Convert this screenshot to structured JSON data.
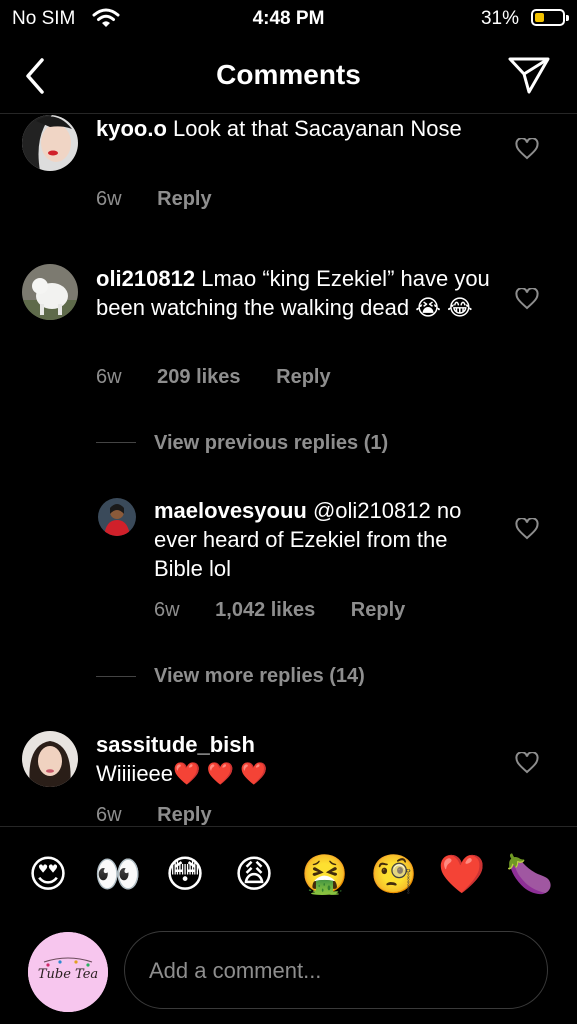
{
  "status_bar": {
    "carrier": "No SIM",
    "time": "4:48 PM",
    "battery": "31%",
    "battery_color": "#f2c200"
  },
  "header": {
    "title": "Comments"
  },
  "comments": [
    {
      "user": "kyoo.o",
      "text": "Look at that Sacayanan Nose",
      "age": "6w",
      "likes": "",
      "reply": "Reply"
    },
    {
      "user": "oli210812",
      "text": "Lmao “king Ezekiel” have you been watching the walking dead 😭 😂",
      "age": "6w",
      "likes": "209 likes",
      "reply": "Reply",
      "view_previous": "View previous replies (1)",
      "replies": [
        {
          "user": "maelovesyouu",
          "text": "@oli210812 no ever heard of Ezekiel from the Bible lol",
          "age": "6w",
          "likes": "1,042 likes",
          "reply": "Reply"
        }
      ],
      "view_more": "View more replies (14)"
    },
    {
      "user": "sassitude_bish",
      "text": "Wiiiieee❤️ ❤️ ❤️",
      "age": "6w",
      "likes": "",
      "reply": "Reply"
    }
  ],
  "quick_emojis": [
    "😍",
    "👀",
    "😳",
    "😩",
    "🤮",
    "🧐",
    "❤️",
    "🍆"
  ],
  "composer": {
    "placeholder": "Add a comment...",
    "avatar_text": "Tube Tea"
  }
}
